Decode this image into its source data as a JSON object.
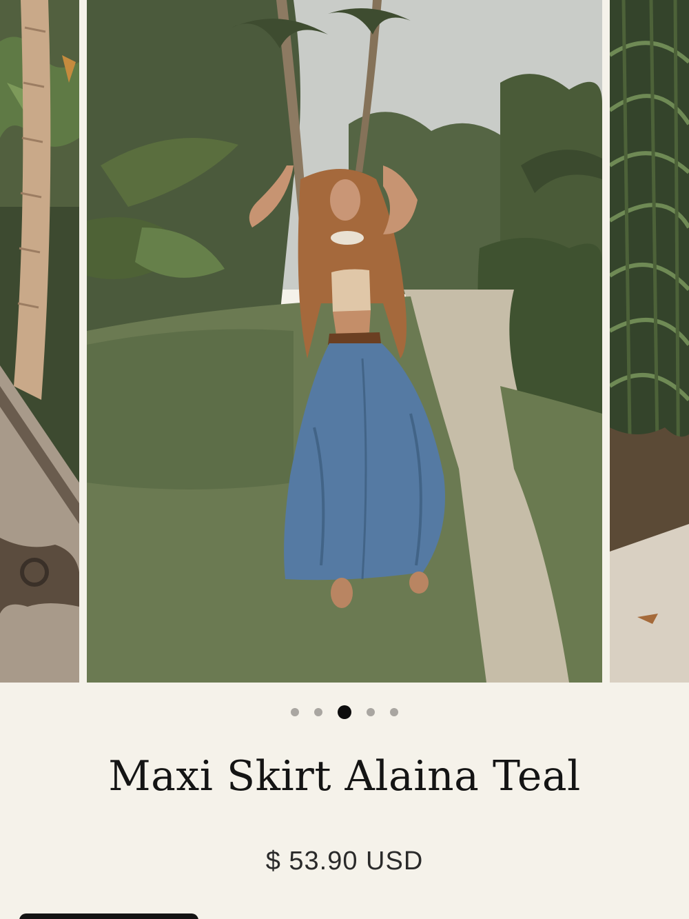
{
  "gallery": {
    "dots_total": 5,
    "active_dot": 3,
    "zoom_icon": "search-icon"
  },
  "product": {
    "title": "Maxi Skirt Alaina Teal",
    "price": "$ 53.90 USD"
  },
  "colors": {
    "background": "#f5f2ea",
    "text": "#141414",
    "dot_active": "#0d0d0d",
    "dot_inactive": "#a9a6a1"
  }
}
